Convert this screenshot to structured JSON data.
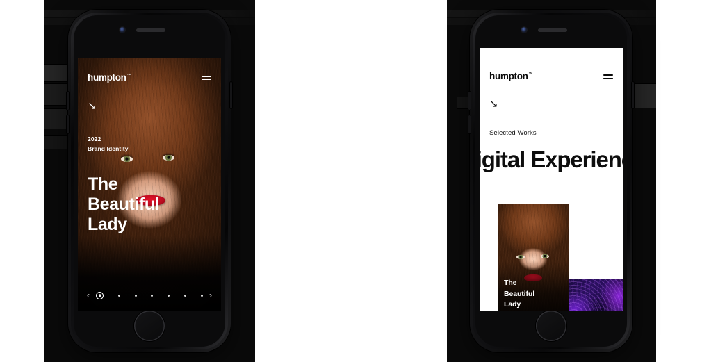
{
  "page": {
    "background_color": "#ffffff",
    "backdrop_color": "#0a0a0a"
  },
  "brand": {
    "name": "humpton",
    "trademark": "™"
  },
  "icons": {
    "menu": "hamburger-menu-icon",
    "scroll_arrow": "↘",
    "prev": "‹",
    "next": "›"
  },
  "phone_one": {
    "label": "iphone-mockup-home",
    "screen": {
      "theme": "dark",
      "logo": "humpton",
      "trademark": "™",
      "scroll_cue": "↘",
      "meta": {
        "year": "2022",
        "category": "Brand Identity"
      },
      "headline_lines": [
        "The",
        "Beautiful",
        "Lady"
      ],
      "carousel": {
        "prev_label": "‹",
        "next_label": "›",
        "total": 7,
        "active_index": 0
      }
    }
  },
  "phone_two": {
    "label": "iphone-mockup-works",
    "screen": {
      "theme": "light",
      "logo": "humpton",
      "trademark": "™",
      "scroll_cue": "↘",
      "eyebrow": "Selected Works",
      "headline": "Digital Experience",
      "cards": [
        {
          "name": "the-beautiful-lady",
          "title_lines": [
            "The",
            "Beautiful",
            "Lady"
          ],
          "media": "portrait-photo"
        },
        {
          "name": "abstract-violet",
          "title_lines": [],
          "media": "abstract-violet-graphic"
        }
      ]
    }
  }
}
